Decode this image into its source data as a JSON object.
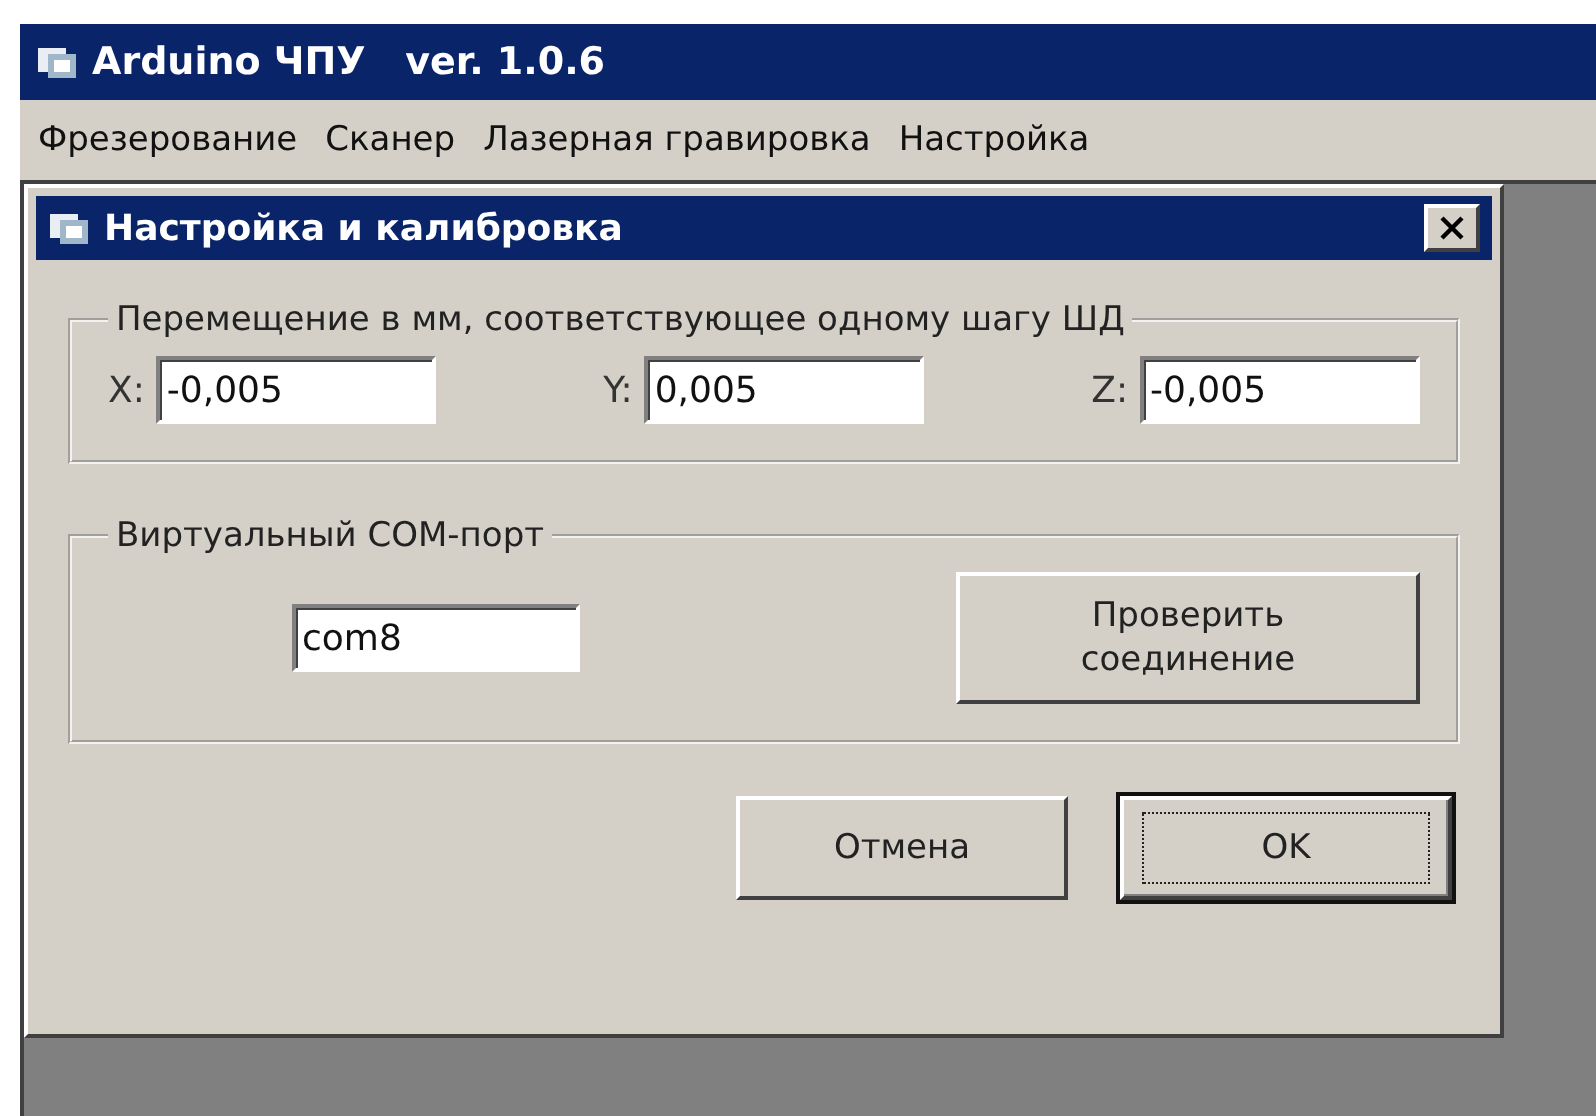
{
  "window": {
    "title": "Arduino ЧПУ   ver. 1.0.6"
  },
  "menu": [
    {
      "label": "Фрезерование"
    },
    {
      "label": "Сканер"
    },
    {
      "label": "Лазерная гравировка"
    },
    {
      "label": "Настройка"
    }
  ],
  "dialog": {
    "title": "Настройка и калибровка",
    "step_group": {
      "legend": "Перемещение в мм, соответствующее одному шагу ШД",
      "fields": [
        {
          "label": "X:",
          "value": "-0,005"
        },
        {
          "label": "Y:",
          "value": "0,005"
        },
        {
          "label": "Z:",
          "value": "-0,005"
        }
      ]
    },
    "port_group": {
      "legend": "Виртуальный COM-порт",
      "value": "com8",
      "button": "Проверить соединение"
    },
    "buttons": [
      {
        "label": "Отмена",
        "default": false
      },
      {
        "label": "OK",
        "default": true
      }
    ]
  }
}
